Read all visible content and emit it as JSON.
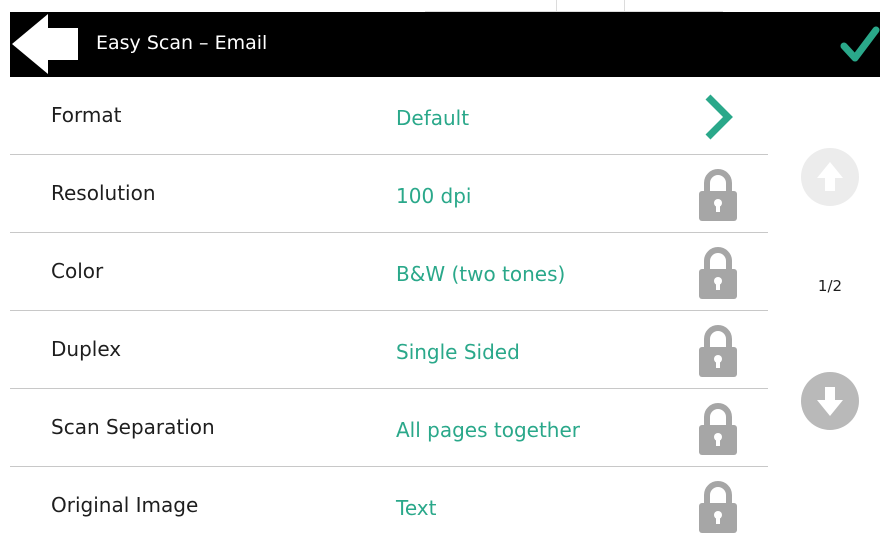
{
  "header": {
    "title": "Easy Scan – Email",
    "back_icon": "back-arrow-icon",
    "confirm_icon": "checkmark-icon"
  },
  "colors": {
    "header_bg": "#000000",
    "accent": "#2aa88a",
    "lock": "#a6a6a6",
    "pager_disabled": "#ececec",
    "pager_enabled": "#b9b9b9"
  },
  "settings": [
    {
      "label": "Format",
      "value": "Default",
      "icon": "chevron-right-icon",
      "locked": false
    },
    {
      "label": "Resolution",
      "value": "100 dpi",
      "icon": "lock-icon",
      "locked": true
    },
    {
      "label": "Color",
      "value": "B&W (two tones)",
      "icon": "lock-icon",
      "locked": true
    },
    {
      "label": "Duplex",
      "value": "Single Sided",
      "icon": "lock-icon",
      "locked": true
    },
    {
      "label": "Scan Separation",
      "value": "All pages together",
      "icon": "lock-icon",
      "locked": true
    },
    {
      "label": "Original Image",
      "value": "Text",
      "icon": "lock-icon",
      "locked": true
    }
  ],
  "pager": {
    "indicator": "1/2",
    "up_enabled": false,
    "down_enabled": true
  }
}
